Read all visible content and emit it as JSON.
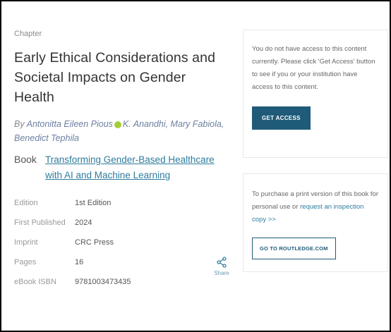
{
  "chapter_label": "Chapter",
  "title": "Early Ethical Considerations and Societal Impacts on Gender Health",
  "authors": {
    "prefix": "By",
    "list": [
      "Antonitta Eileen Pious",
      "K. Anandhi, Mary Fabiola, Benedict Tephila"
    ]
  },
  "book": {
    "label": "Book",
    "link_text": "Transforming Gender-Based Healthcare with AI and Machine Learning"
  },
  "meta": [
    {
      "key": "Edition",
      "value": "1st Edition"
    },
    {
      "key": "First Published",
      "value": "2024"
    },
    {
      "key": "Imprint",
      "value": "CRC Press"
    },
    {
      "key": "Pages",
      "value": "16"
    },
    {
      "key": "eBook ISBN",
      "value": "9781003473435"
    }
  ],
  "share": {
    "label": "Share",
    "icon": "share-icon"
  },
  "access_card": {
    "text": "You do not have access to this content currently. Please click 'Get Access' button to see if you or your institution have access to this content.",
    "button": "GET ACCESS"
  },
  "purchase_card": {
    "text_before": "To purchase a print version of this book for personal use or ",
    "link": "request an inspection copy >>",
    "button": "GO TO ROUTLEDGE.COM"
  },
  "colors": {
    "accent": "#1f5b78",
    "link": "#2e7c9e",
    "orcid": "#a6ce39"
  }
}
